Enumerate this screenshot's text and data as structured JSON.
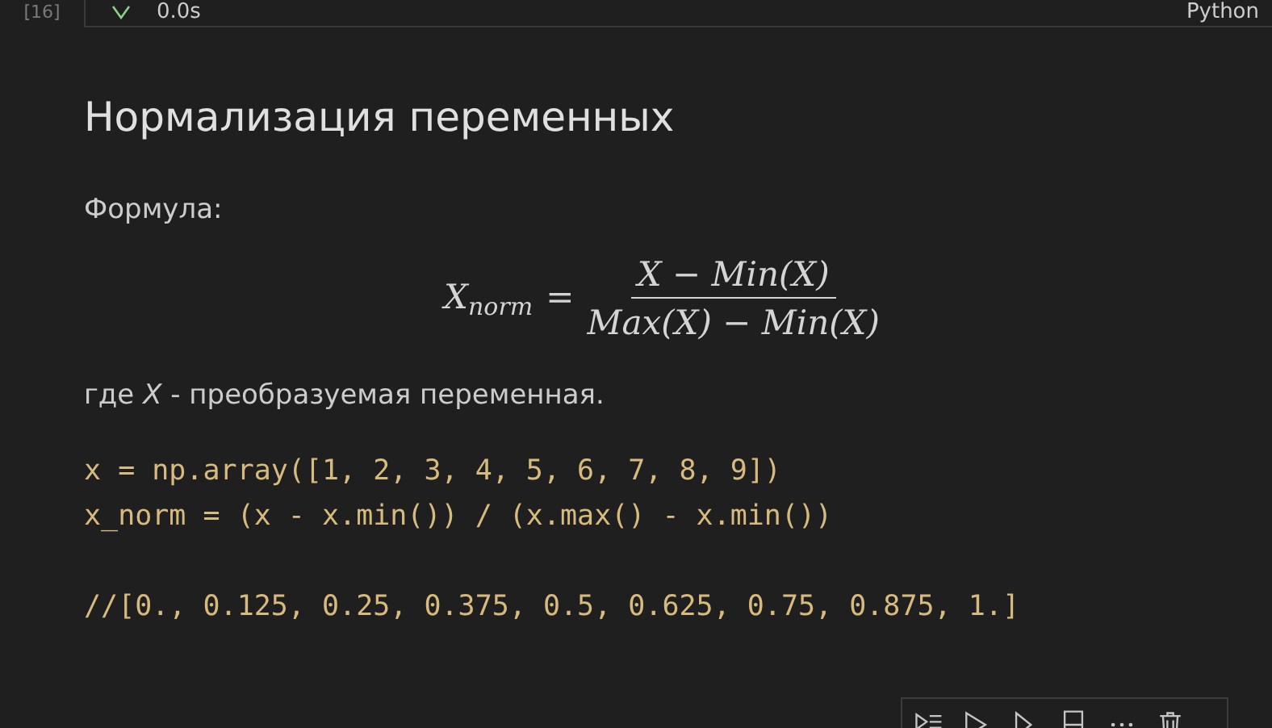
{
  "previous_cell": {
    "execution_count": "[16]",
    "succeeded": true,
    "duration": "0.0s",
    "language": "Python"
  },
  "markdown": {
    "heading": "Нормализация переменных",
    "label": "Формула:",
    "formula": {
      "lhs": "X",
      "lhs_sub": "norm",
      "equals": "=",
      "numerator": "X − Min(X)",
      "denominator": "Max(X) − Min(X)"
    },
    "description": "где *X* - преобразуемая переменная.",
    "code_lines": [
      "x = np.array([1, 2, 3, 4, 5, 6, 7, 8, 9])",
      "x_norm = (x - x.min()) / (x.max() - x.min())"
    ],
    "result_line": "//[0., 0.125, 0.25, 0.375, 0.5, 0.625, 0.75, 0.875, 1.]"
  }
}
